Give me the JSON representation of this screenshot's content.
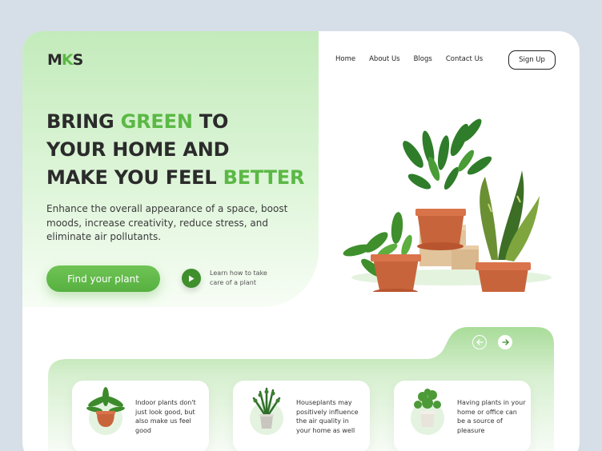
{
  "brand": {
    "logo_main": "M",
    "logo_k": "K",
    "logo_end": "S"
  },
  "nav": {
    "items": [
      "Home",
      "About Us",
      "Blogs",
      "Contact Us"
    ],
    "signup_label": "Sign Up"
  },
  "hero": {
    "line1_a": "BRING ",
    "line1_green": "GREEN",
    "line1_b": " TO",
    "line2": "YOUR HOME AND",
    "line3_a": "MAKE YOU FEEL ",
    "line3_green": "BETTER",
    "description": "Enhance the overall appearance of a space, boost moods, increase creativity, reduce stress, and eliminate air pollutants.",
    "cta_label": "Find your plant",
    "play_text": "Learn how to take care of a plant"
  },
  "carousel": {
    "prev_icon": "arrow-left-icon",
    "next_icon": "arrow-right-icon"
  },
  "features": [
    {
      "text": "Indoor plants don't just look good, but also make us feel good",
      "icon": "potted-plant-icon"
    },
    {
      "text": "Houseplants may positively influence the air quality in your home as well",
      "icon": "zz-plant-icon"
    },
    {
      "text": "Having plants in your home or office can be a source of pleasure",
      "icon": "leafy-plant-icon"
    }
  ],
  "colors": {
    "accent": "#5bb845",
    "dark": "#2b2b2b",
    "background": "#d6dee8",
    "hero_bg": "#c3ebbb",
    "pot": "#c8643c"
  }
}
